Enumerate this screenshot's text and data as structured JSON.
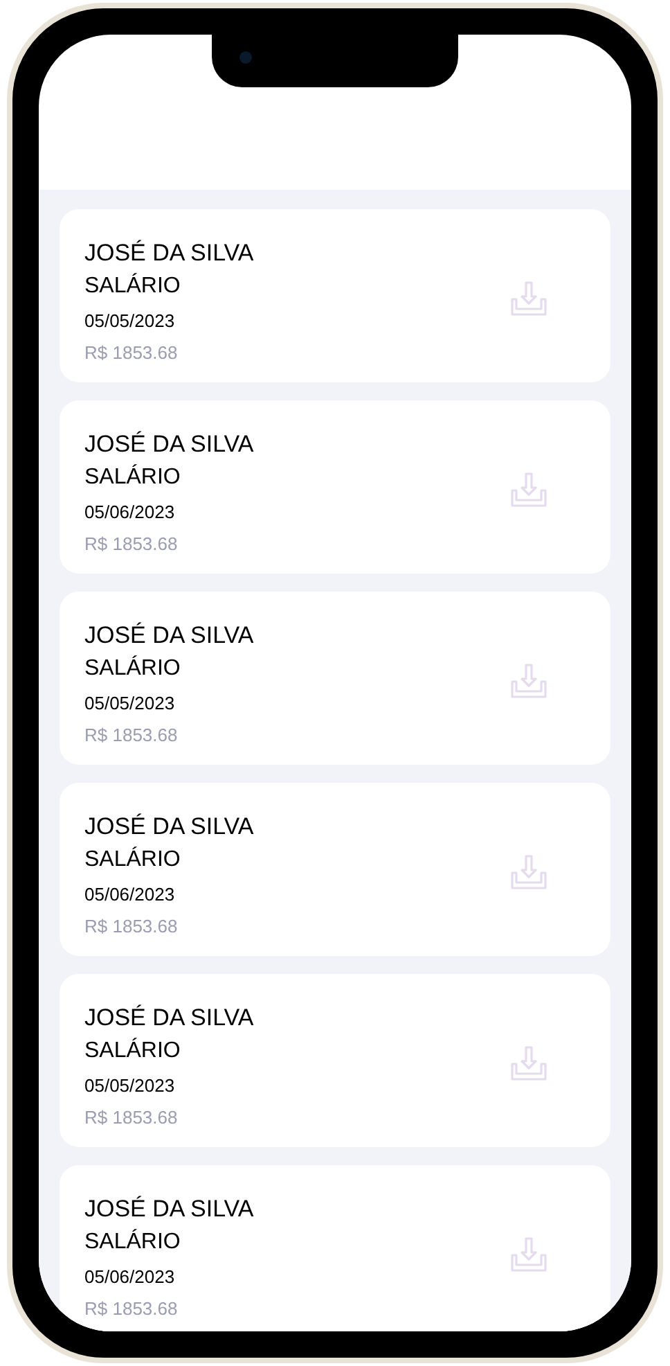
{
  "payslips": [
    {
      "name": "JOSÉ DA SILVA",
      "category": "SALÁRIO",
      "date": "05/05/2023",
      "amount": "R$ 1853.68"
    },
    {
      "name": "JOSÉ DA SILVA",
      "category": "SALÁRIO",
      "date": "05/06/2023",
      "amount": "R$ 1853.68"
    },
    {
      "name": "JOSÉ DA SILVA",
      "category": "SALÁRIO",
      "date": "05/05/2023",
      "amount": "R$ 1853.68"
    },
    {
      "name": "JOSÉ DA SILVA",
      "category": "SALÁRIO",
      "date": "05/06/2023",
      "amount": "R$ 1853.68"
    },
    {
      "name": "JOSÉ DA SILVA",
      "category": "SALÁRIO",
      "date": "05/05/2023",
      "amount": "R$ 1853.68"
    },
    {
      "name": "JOSÉ DA SILVA",
      "category": "SALÁRIO",
      "date": "05/06/2023",
      "amount": "R$ 1853.68"
    }
  ]
}
